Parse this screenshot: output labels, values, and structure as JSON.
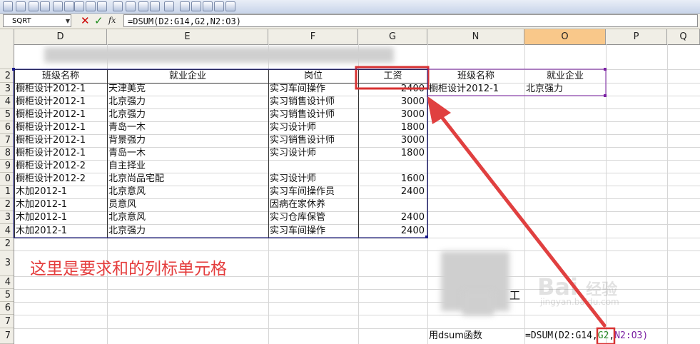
{
  "formula_bar": {
    "name_box": "SQRT",
    "formula": "=DSUM(D2:G14,G2,N2:O3)"
  },
  "columns": [
    "D",
    "E",
    "F",
    "G",
    "N",
    "O",
    "P",
    "Q"
  ],
  "rows": [
    "",
    "2",
    "3",
    "4",
    "5",
    "6",
    "7",
    "8",
    "9",
    "0",
    "1",
    "2",
    "3",
    "4",
    "2",
    "3",
    "4",
    "5",
    "6",
    "7"
  ],
  "header_row": {
    "D": "班级名称",
    "E": "就业企业",
    "F": "岗位",
    "G": "工资",
    "N": "班级名称",
    "O": "就业企业"
  },
  "table_rows": [
    {
      "D": "橱柜设计2012-1",
      "E": "天津美克",
      "F": "实习车间操作",
      "G": "2400"
    },
    {
      "D": "橱柜设计2012-1",
      "E": "北京强力",
      "F": "实习销售设计师",
      "G": "3000"
    },
    {
      "D": "橱柜设计2012-1",
      "E": "北京强力",
      "F": "实习销售设计师",
      "G": "3000"
    },
    {
      "D": "橱柜设计2012-1",
      "E": "青岛一木",
      "F": "实习设计师",
      "G": "1800"
    },
    {
      "D": "橱柜设计2012-1",
      "E": "背景强力",
      "F": "实习销售设计师",
      "G": "3000"
    },
    {
      "D": "橱柜设计2012-1",
      "E": "青岛一木",
      "F": "实习设计师",
      "G": "1800"
    },
    {
      "D": "橱柜设计2012-2",
      "E": "自主择业",
      "F": "",
      "G": ""
    },
    {
      "D": "橱柜设计2012-2",
      "E": "北京尚品宅配",
      "F": "实习设计师",
      "G": "1600"
    },
    {
      "D": "木加2012-1",
      "E": "北京意风",
      "F": "实习车间操作员",
      "G": "2400"
    },
    {
      "D": "木加2012-1",
      "E": "员意风",
      "F": "因病在家休养",
      "G": ""
    },
    {
      "D": "木加2012-1",
      "E": "北京意风",
      "F": "实习仓库保管",
      "G": "2400"
    },
    {
      "D": "木加2012-1",
      "E": "北京强力",
      "F": "实习车间操作",
      "G": "2400"
    }
  ],
  "criteria_row": {
    "N": "橱柜设计2012-1",
    "O": "北京强力"
  },
  "annotation": "这里是要求和的列标单元格",
  "side_text": {
    "col_n_row_17": "用dsum函数",
    "label_gong": "工"
  },
  "formula_cell": {
    "p1": "=DSUM(D2:G14,",
    "p2": "G2",
    "p3": ",",
    "p4": "N2:O3)"
  },
  "watermark": {
    "line1": "Bai",
    "line2": "jingyan.baidu.com",
    "mark": "经验"
  },
  "colors": {
    "annotation": "#e43c3c",
    "highlight_box": "#d83232",
    "arrow": "#e04040",
    "active_column": "#f9c88a"
  }
}
